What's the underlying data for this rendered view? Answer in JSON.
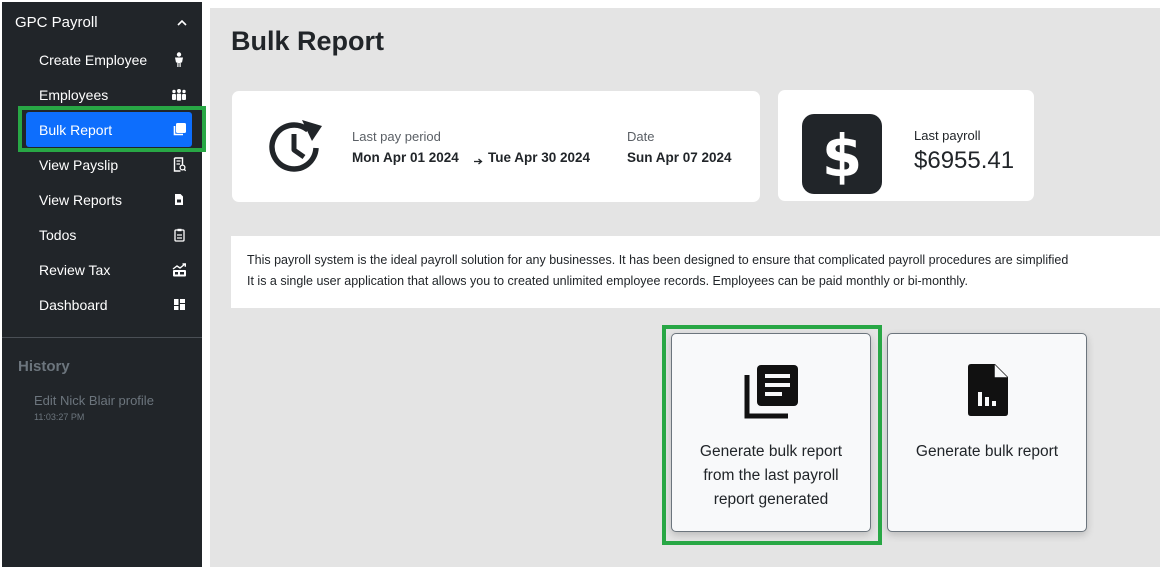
{
  "sidebar": {
    "brand": "GPC Payroll",
    "items": [
      {
        "label": "Create Employee",
        "icon": "person-icon"
      },
      {
        "label": "Employees",
        "icon": "people-icon"
      },
      {
        "label": "Bulk Report",
        "icon": "copy-icon",
        "active": true
      },
      {
        "label": "View Payslip",
        "icon": "receipt-icon"
      },
      {
        "label": "View Reports",
        "icon": "file-icon"
      },
      {
        "label": "Todos",
        "icon": "clipboard-icon"
      },
      {
        "label": "Review Tax",
        "icon": "tax-chart-icon"
      },
      {
        "label": "Dashboard",
        "icon": "dashboard-icon"
      }
    ],
    "history": {
      "title": "History",
      "items": [
        {
          "label": "Edit Nick Blair profile",
          "time": "11:03:27 PM"
        }
      ]
    }
  },
  "main": {
    "title": "Bulk Report",
    "period_card": {
      "last_pay_period_label": "Last pay period",
      "period_start": "Mon Apr 01 2024",
      "period_end": "Tue Apr 30 2024",
      "date_label": "Date",
      "date_value": "Sun Apr 07 2024"
    },
    "last_payroll_card": {
      "label": "Last payroll",
      "amount": "$6955.41"
    },
    "info": {
      "line1": "This payroll system is the ideal payroll solution for any businesses. It has been designed to ensure that complicated payroll procedures are simplified",
      "line2": "It is a single user application that allows you to created unlimited employee records. Employees can be paid monthly or bi-monthly."
    },
    "actions": {
      "from_last": {
        "line1": "Generate bulk report",
        "line2": "from the last payroll",
        "line3": "report generated"
      },
      "generate": {
        "label": "Generate bulk report"
      }
    }
  },
  "colors": {
    "sidebar_bg": "#212529",
    "active_bg": "#0d6efd",
    "main_bg": "#e4e4e4",
    "highlight": "#28a745"
  }
}
